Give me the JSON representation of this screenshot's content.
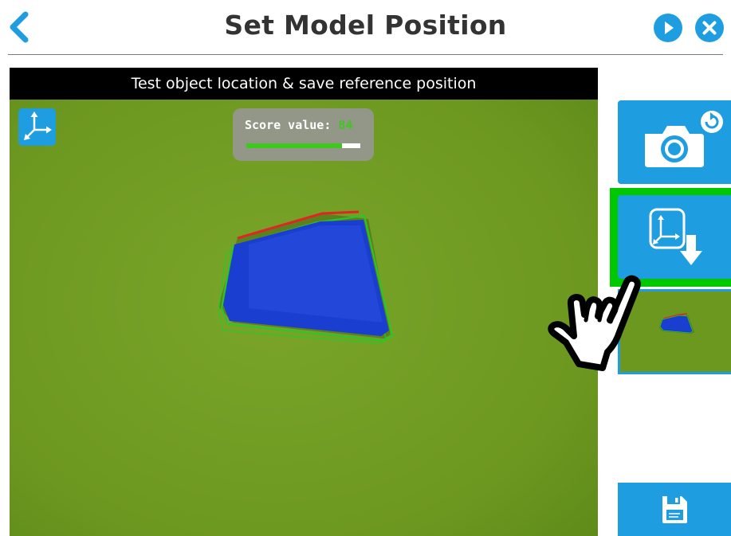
{
  "header": {
    "title": "Set Model Position",
    "back_icon": "chevron-left-icon",
    "play_icon": "play-icon",
    "close_icon": "close-icon"
  },
  "camera": {
    "banner": "Test object location & save reference position",
    "axes_icon": "axes-icon",
    "score": {
      "label": "Score value:",
      "value": "84",
      "fraction": 0.84
    }
  },
  "side_panel": {
    "snapshot_icon": "camera-refresh-icon",
    "save_reference_icon": "save-reference-position-icon",
    "thumbnail": "model-thumbnail",
    "save_icon": "floppy-disk-icon",
    "pointer_icon": "hand-pointer-icon"
  },
  "colors": {
    "accent": "#1e9ee0",
    "highlight": "#00c800",
    "score_green": "#3ec81e",
    "object_blue": "#1a3fd0",
    "background_green": "#6f9a22"
  }
}
